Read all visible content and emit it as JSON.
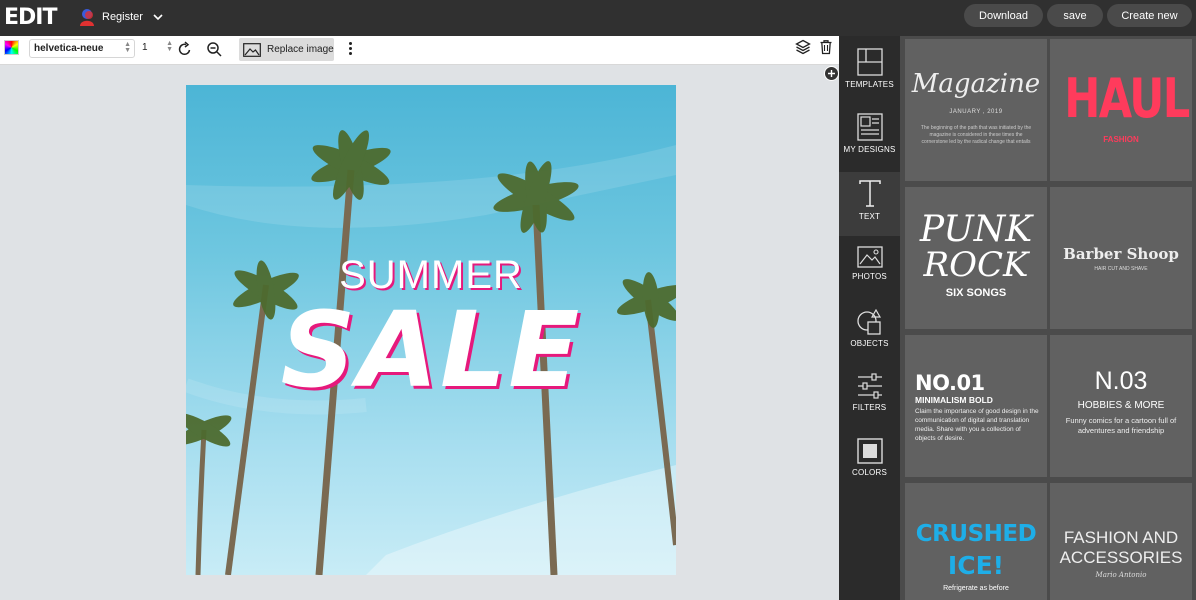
{
  "app": {
    "logo": "EDIT"
  },
  "header": {
    "register_label": "Register",
    "download_label": "Download",
    "save_label": "save",
    "create_new_label": "Create new"
  },
  "toolbar": {
    "font_value": "helvetica-neue",
    "font_size_value": "1",
    "replace_image_label": "Replace image"
  },
  "canvas": {
    "headline": "SUMMER",
    "subhead": "SALE"
  },
  "sidebar": {
    "items": [
      {
        "label": "TEMPLATES",
        "icon": "templates-icon"
      },
      {
        "label": "MY DESIGNS",
        "icon": "my-designs-icon"
      },
      {
        "label": "TEXT",
        "icon": "text-icon",
        "active": true
      },
      {
        "label": "PHOTOS",
        "icon": "photos-icon"
      },
      {
        "label": "OBJECTS",
        "icon": "objects-icon"
      },
      {
        "label": "FILTERS",
        "icon": "filters-icon"
      },
      {
        "label": "COLORS",
        "icon": "colors-icon"
      }
    ]
  },
  "text_templates": {
    "magazine": {
      "title": "Magazine",
      "date": "JANUARY , 2019",
      "body": "The beginning of the path that was initiated by the magazine is considered in these times the cornerstone led by the radical change that entails"
    },
    "haul": {
      "title": "HAUL",
      "sub": "FASHION"
    },
    "punk": {
      "line1": "PUNK",
      "line2": "ROCK",
      "sub": "SIX SONGS"
    },
    "barber": {
      "title": "Barber Shoop",
      "sub": "HAIR CUT AND SHAVE"
    },
    "no01": {
      "title": "NO.01",
      "sub": "MINIMALISM BOLD",
      "body": "Claim the importance of good design in the communication of digital and translation media. Share with you a collection of objects of desire."
    },
    "n03": {
      "title": "N.03",
      "sub": "HOBBIES & MORE",
      "body": "Funny comics for a cartoon full of adventures and friendship"
    },
    "crushed": {
      "line1": "CRUSHED",
      "line2": "ICE!",
      "sub": "Refrigerate as before"
    },
    "fashion": {
      "line1": "FASHION AND",
      "line2": "ACCESSORIES",
      "sub": "Mario Antonio"
    }
  },
  "colors": {
    "topbar": "#303030",
    "sidebar": "#2b2b2b",
    "panel": "#4b4b4b",
    "accent_pink": "#e6197c",
    "haul_red": "#ff3b5c",
    "crushed_blue": "#1eaee8"
  }
}
